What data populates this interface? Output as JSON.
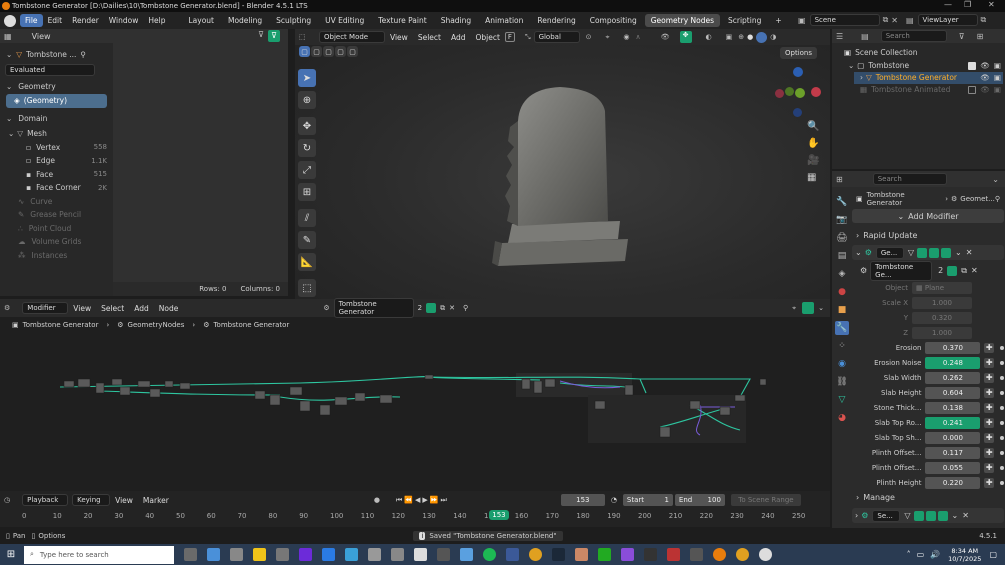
{
  "window": {
    "title": "Tombstone Generator [D:\\Dailies\\10\\Tombstone Generator.blend] - Blender 4.5.1 LTS"
  },
  "menu": {
    "items": [
      "File",
      "Edit",
      "Render",
      "Window",
      "Help"
    ]
  },
  "workspaces": [
    "Layout",
    "Modeling",
    "Sculpting",
    "UV Editing",
    "Texture Paint",
    "Shading",
    "Animation",
    "Rendering",
    "Compositing",
    "Geometry Nodes",
    "Scripting"
  ],
  "top_right": {
    "scene": "Scene",
    "view_layer": "ViewLayer"
  },
  "left_panel": {
    "header": "View",
    "object_name": "Tombstone ...",
    "evaluated": "Evaluated",
    "geometry_section": "Geometry",
    "geometry_item": "(Geometry)",
    "domain_section": "Domain",
    "mesh": "Mesh",
    "domains": [
      {
        "label": "Vertex",
        "count": "558"
      },
      {
        "label": "Edge",
        "count": "1.1K"
      },
      {
        "label": "Face",
        "count": "515"
      },
      {
        "label": "Face Corner",
        "count": "2K"
      }
    ],
    "other": [
      "Curve",
      "Grease Pencil",
      "Point Cloud",
      "Volume Grids",
      "Instances"
    ]
  },
  "spreadsheet": {
    "rows": "Rows: 0",
    "columns": "Columns: 0"
  },
  "viewport": {
    "mode": "Object Mode",
    "menus": [
      "View",
      "Select",
      "Add",
      "Object"
    ],
    "orientation": "Global",
    "options": "Options"
  },
  "outliner": {
    "search_placeholder": "Search",
    "root": "Scene Collection",
    "collection": "Tombstone",
    "item1": "Tombstone Generator",
    "item2": "Tombstone Animated"
  },
  "properties": {
    "search_placeholder": "Search",
    "breadcrumb1": "Tombstone Generator",
    "breadcrumb2": "Geomet...",
    "add_modifier": "Add Modifier",
    "rapid_update": "Rapid Update",
    "modifier_name": "Ge...",
    "nodegroup": "Tombstone Ge...",
    "nodegroup_users": "2",
    "object_label": "Object",
    "object_value": "Plane",
    "scale": [
      {
        "label": "Scale X",
        "value": "1.000"
      },
      {
        "label": "Y",
        "value": "0.320"
      },
      {
        "label": "Z",
        "value": "1.000"
      }
    ],
    "params": [
      {
        "label": "Erosion",
        "value": "0.370",
        "green": false
      },
      {
        "label": "Erosion Noise",
        "value": "0.248",
        "green": true
      },
      {
        "label": "Slab Width",
        "value": "0.262",
        "green": false
      },
      {
        "label": "Slab Height",
        "value": "0.604",
        "green": false
      },
      {
        "label": "Stone Thick...",
        "value": "0.138",
        "green": false
      },
      {
        "label": "Slab Top Ro...",
        "value": "0.241",
        "green": true
      },
      {
        "label": "Slab Top Sh...",
        "value": "0.000",
        "green": false
      },
      {
        "label": "Plinth Offset...",
        "value": "0.117",
        "green": false
      },
      {
        "label": "Plinth Offset...",
        "value": "0.055",
        "green": false
      },
      {
        "label": "Plinth Height",
        "value": "0.220",
        "green": false
      }
    ],
    "manage": "Manage",
    "modifier2_name": "Se..."
  },
  "node_editor": {
    "editor_type": "Modifier",
    "menus": [
      "View",
      "Select",
      "Add",
      "Node"
    ],
    "nodegroup": "Tombstone Generator",
    "users": "2",
    "breadcrumb": [
      "Tombstone Generator",
      "GeometryNodes",
      "Tombstone Generator"
    ]
  },
  "timeline": {
    "menus": [
      "Playback",
      "Keying",
      "View",
      "Marker"
    ],
    "current_frame": "153",
    "start_label": "Start",
    "start": "1",
    "end_label": "End",
    "end": "100",
    "to_scene_range": "To Scene Range",
    "ticks": [
      "0",
      "10",
      "20",
      "30",
      "40",
      "50",
      "60",
      "70",
      "80",
      "90",
      "100",
      "110",
      "120",
      "130",
      "140",
      "150",
      "160",
      "170",
      "180",
      "190",
      "200",
      "210",
      "220",
      "230",
      "240",
      "250"
    ],
    "playhead": "153"
  },
  "statusbar": {
    "pan": "Pan",
    "options": "Options",
    "message": "Saved \"Tombstone Generator.blend\"",
    "version": "4.5.1"
  },
  "taskbar": {
    "search_placeholder": "Type here to search",
    "time": "8:34 AM",
    "date": "10/7/2025"
  },
  "colors": {
    "accent": "#4772b3",
    "green": "#1a9e6e",
    "node_link": "#2ec6a0"
  }
}
